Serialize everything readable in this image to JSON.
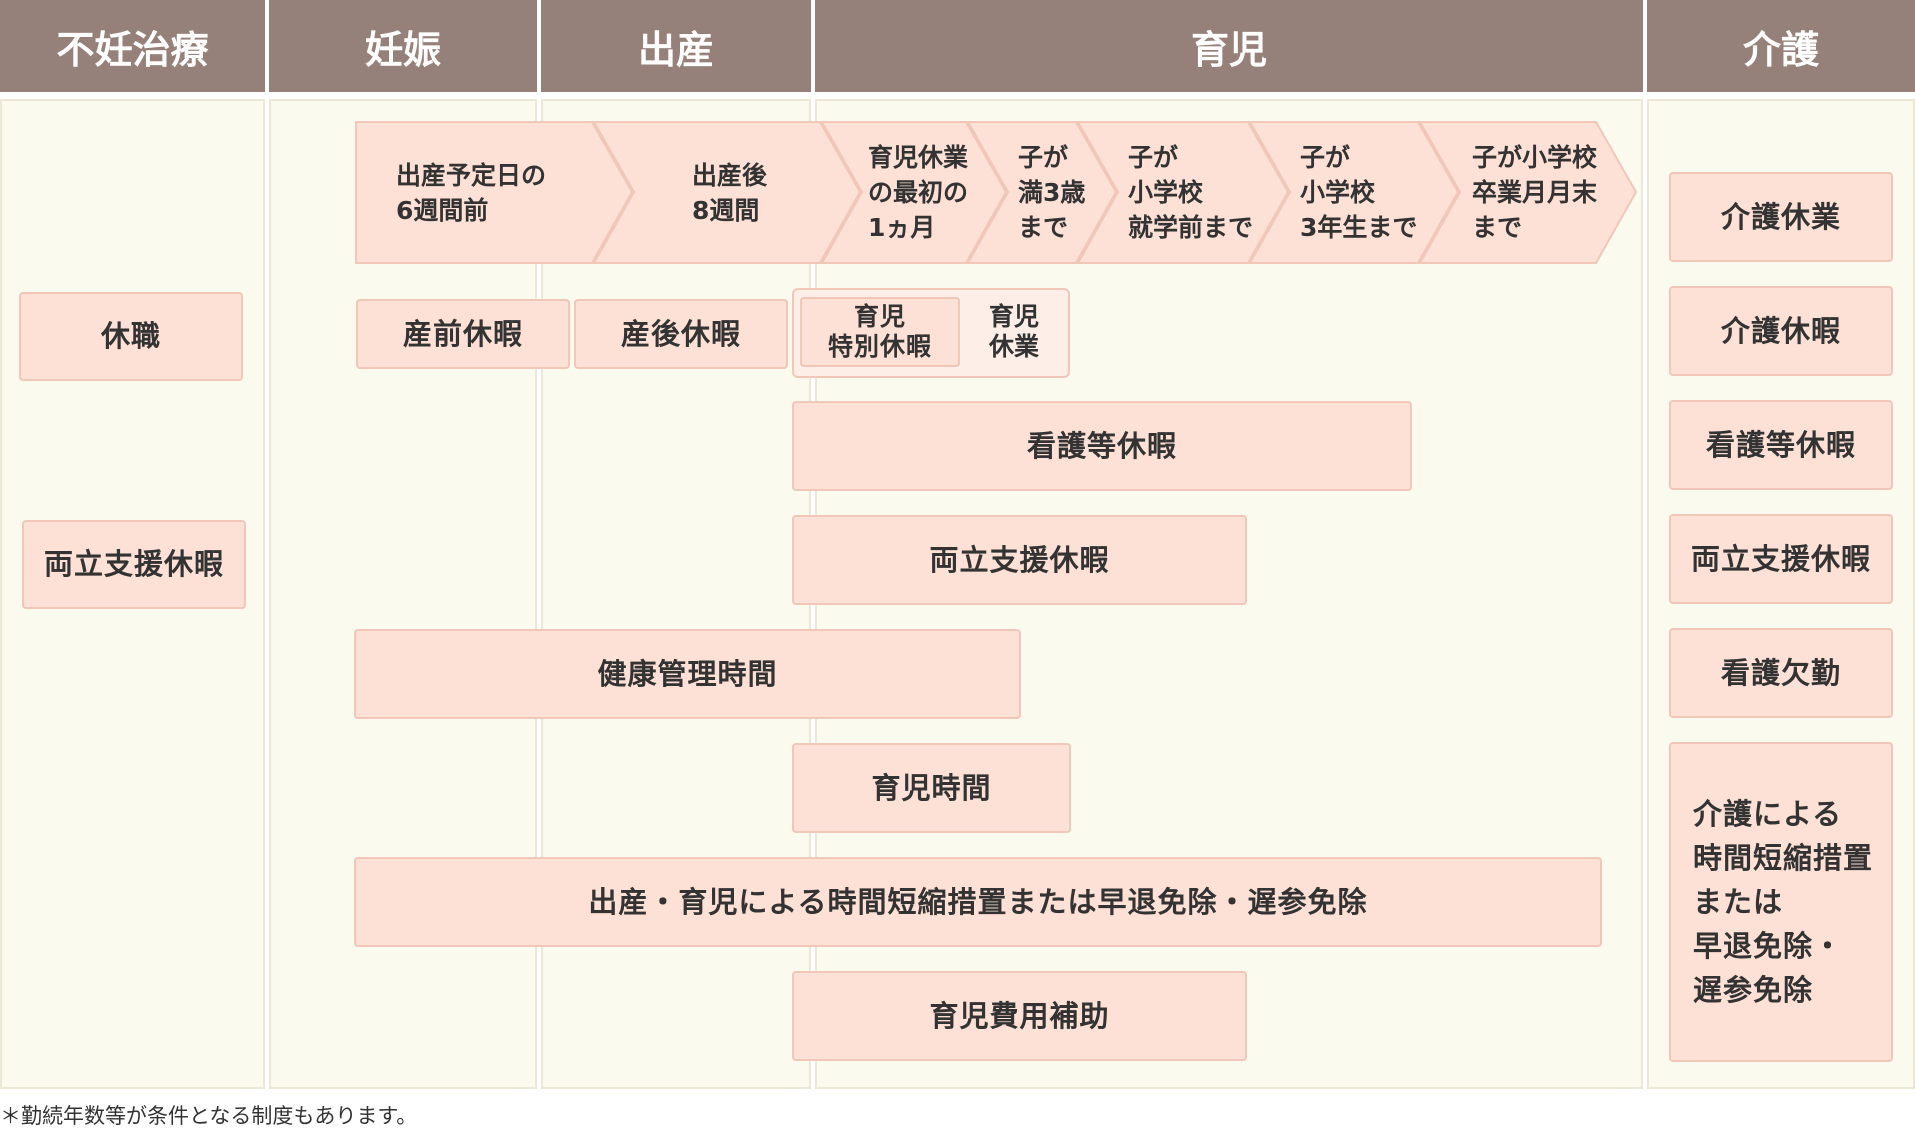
{
  "headers": [
    "不妊治療",
    "妊娠",
    "出産",
    "育児",
    "介護"
  ],
  "timeline": [
    "出産予定日の\n6週間前",
    "出産後\n8週間",
    "育児休業\nの最初の\n1ヵ月",
    "子が\n満3歳\nまで",
    "子が\n小学校\n就学前まで",
    "子が\n小学校\n3年生まで",
    "子が小学校\n卒業月月末\nまで"
  ],
  "fertility": {
    "leave": "休職",
    "support_leave": "両立支援休暇"
  },
  "main": {
    "prenatal_leave": "産前休暇",
    "postnatal_leave": "産後休暇",
    "childcare_special_leave": "育児\n特別休暇",
    "childcare_leave": "育児\n休業",
    "nursing_leave": "看護等休暇",
    "support_leave": "両立支援休暇",
    "health_mgmt_time": "健康管理時間",
    "childcare_time": "育児時間",
    "short_hours": "出産・育児による時間短縮措置または早退免除・遅参免除",
    "childcare_subsidy": "育児費用補助"
  },
  "care": {
    "care_leave_long": "介護休業",
    "care_leave": "介護休暇",
    "nursing_leave": "看護等休暇",
    "support_leave": "両立支援休暇",
    "nursing_absence": "看護欠勤",
    "short_hours": "介護による\n時間短縮措置\nまたは\n早退免除・\n遅参免除"
  },
  "footnote": "＊勤続年数等が条件となる制度もあります。",
  "colors": {
    "header_bg": "#96807a",
    "column_bg": "#fafaef",
    "box_fill": "#fde0d6",
    "box_border": "#f0c7b8"
  }
}
